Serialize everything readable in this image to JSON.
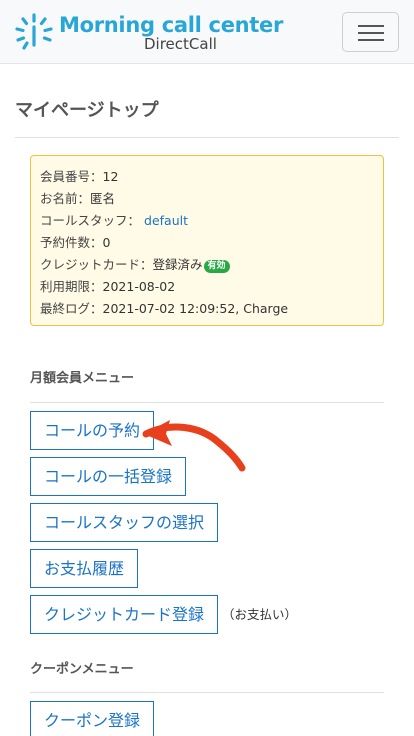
{
  "header": {
    "brand_name": "Morning call center",
    "brand_sub": "DirectCall",
    "logo_icon": "sunrise-logo-icon",
    "menu_icon": "hamburger-icon"
  },
  "page": {
    "title": "マイページトップ"
  },
  "member_info": {
    "member_no_label": "会員番号：",
    "member_no": "12",
    "name_label": "お名前：",
    "name": "匿名",
    "staff_label": "コールスタッフ：",
    "staff": "default",
    "reservations_label": "予約件数：",
    "reservations": "0",
    "credit_label": "クレジットカード：",
    "credit_status": "登録済み",
    "credit_badge": "有効",
    "expiry_label": "利用期限：",
    "expiry": "2021-08-02",
    "last_log_label": "最終ログ：",
    "last_log": "2021-07-02 12:09:52, Charge"
  },
  "monthly_menu": {
    "heading": "月額会員メニュー",
    "items": [
      {
        "label": "コールの予約"
      },
      {
        "label": "コールの一括登録"
      },
      {
        "label": "コールスタッフの選択"
      },
      {
        "label": "お支払履歴"
      },
      {
        "label": "クレジットカード登録"
      }
    ],
    "credit_note": "（お支払い）"
  },
  "coupon_menu": {
    "heading": "クーポンメニュー",
    "items": [
      {
        "label": "クーポン登録"
      }
    ]
  },
  "colors": {
    "accent": "#1a73c8",
    "brand": "#29a6d8",
    "info_bg": "#fffbe6",
    "info_border": "#f0c040",
    "badge": "#28a745",
    "annotation_arrow": "#e8401c"
  }
}
